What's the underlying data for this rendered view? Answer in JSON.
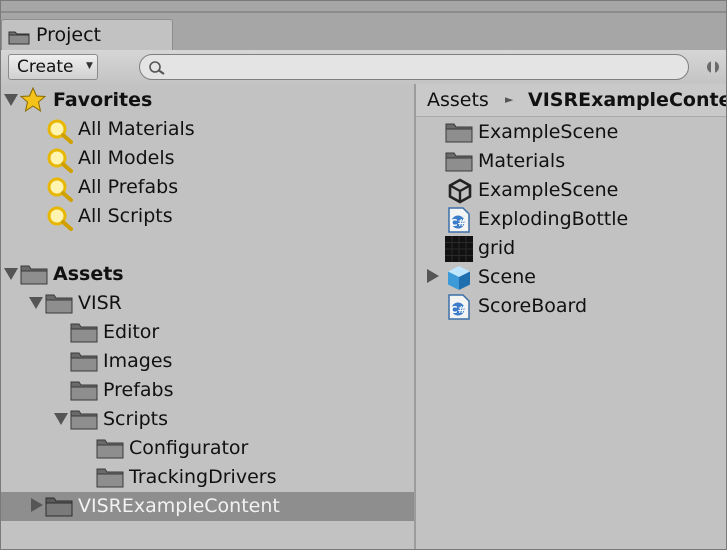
{
  "tab": {
    "label": "Project",
    "icon": "folder-icon"
  },
  "toolbar": {
    "create_label": "Create",
    "search_placeholder": ""
  },
  "tree": {
    "favorites": {
      "label": "Favorites",
      "items": [
        "All Materials",
        "All Models",
        "All Prefabs",
        "All Scripts"
      ]
    },
    "assets": {
      "label": "Assets",
      "visr": "VISR",
      "visr_children": [
        "Editor",
        "Images",
        "Prefabs",
        "Scripts"
      ],
      "scripts_children": [
        "Configurator",
        "TrackingDrivers"
      ],
      "example_content": "VISRExampleContent"
    }
  },
  "breadcrumb": [
    "Assets",
    "VISRExampleContent"
  ],
  "assets_list": [
    {
      "label": "ExampleScene",
      "icon": "folder-icon"
    },
    {
      "label": "Materials",
      "icon": "folder-icon"
    },
    {
      "label": "ExampleScene",
      "icon": "unity-scene-icon"
    },
    {
      "label": "ExplodingBottle",
      "icon": "csharp-script-icon"
    },
    {
      "label": "grid",
      "icon": "texture-icon"
    },
    {
      "label": "Scene",
      "icon": "prefab-cube-icon"
    },
    {
      "label": "ScoreBoard",
      "icon": "csharp-script-icon"
    }
  ],
  "colors": {
    "panel": "#c2c2c2",
    "selection": "#8e8e8e",
    "folder": "#7e7e7e",
    "search_icon": "#e8b800"
  }
}
